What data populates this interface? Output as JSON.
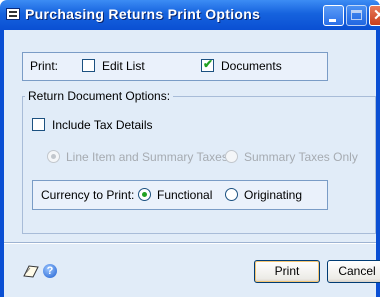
{
  "window": {
    "title": "Purchasing Returns Print Options",
    "icon": "document-window-icon"
  },
  "print_section": {
    "label": "Print:",
    "edit_list": {
      "label": "Edit List",
      "checked": false
    },
    "documents": {
      "label": "Documents",
      "checked": true
    }
  },
  "return_document_options": {
    "legend": "Return Document Options:",
    "include_tax_details": {
      "label": "Include Tax Details",
      "checked": false
    },
    "tax_mode": {
      "enabled": false,
      "options": [
        {
          "label": "Line Item and Summary Taxes",
          "selected": true
        },
        {
          "label": "Summary Taxes Only",
          "selected": false
        }
      ]
    },
    "currency": {
      "label": "Currency to Print:",
      "options": [
        {
          "label": "Functional",
          "selected": true
        },
        {
          "label": "Originating",
          "selected": false
        }
      ]
    }
  },
  "footer": {
    "note_icon": "note-icon",
    "help_icon": "help-icon",
    "help_glyph": "?",
    "print_button": "Print",
    "cancel_button": "Cancel"
  },
  "colors": {
    "title_bar": "#0a4fd3",
    "window_background": "#e1ecf8",
    "check_mark": "#21a121"
  }
}
